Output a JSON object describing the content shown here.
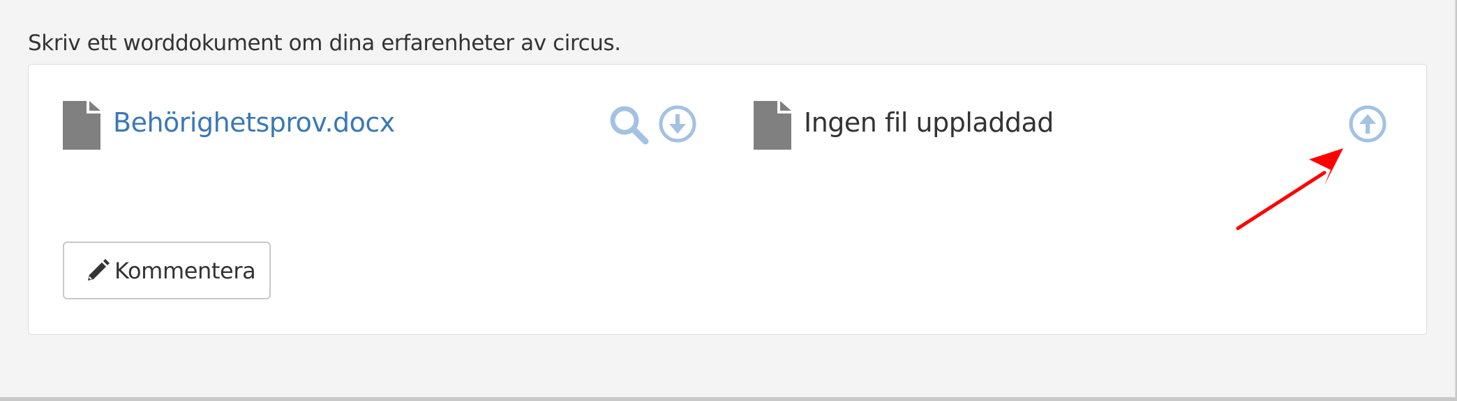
{
  "task": {
    "instructions": "Skriv ett worddokument om dina erfarenheter av circus."
  },
  "files": {
    "template": {
      "name": "Behörighetsprov.docx",
      "icon": "file-icon",
      "actions": [
        "search-icon",
        "download-icon"
      ]
    },
    "submission": {
      "status": "Ingen fil uppladdad",
      "icon": "file-icon",
      "actions": [
        "upload-icon"
      ]
    }
  },
  "comment_button": {
    "icon": "pencil-icon",
    "label": "Kommentera"
  },
  "colors": {
    "link": "#3a78b5",
    "action_icon": "#a3c2e3",
    "file_icon": "#808080",
    "annotation_arrow": "#ff0000"
  }
}
